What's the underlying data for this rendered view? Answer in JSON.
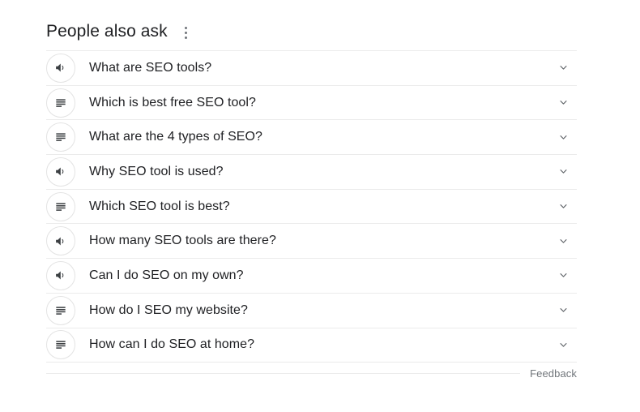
{
  "module": {
    "title": "People also ask",
    "kebab_menu_label": "More options",
    "feedback_label": "Feedback"
  },
  "questions": [
    {
      "text": "What are SEO tools?",
      "icon": "speaker-icon",
      "expand_icon": "chevron-down-icon"
    },
    {
      "text": "Which is best free SEO tool?",
      "icon": "text-lines-icon",
      "expand_icon": "chevron-down-icon"
    },
    {
      "text": "What are the 4 types of SEO?",
      "icon": "text-lines-icon",
      "expand_icon": "chevron-down-icon"
    },
    {
      "text": "Why SEO tool is used?",
      "icon": "speaker-icon",
      "expand_icon": "chevron-down-icon"
    },
    {
      "text": "Which SEO tool is best?",
      "icon": "text-lines-icon",
      "expand_icon": "chevron-down-icon"
    },
    {
      "text": "How many SEO tools are there?",
      "icon": "speaker-icon",
      "expand_icon": "chevron-down-icon"
    },
    {
      "text": "Can I do SEO on my own?",
      "icon": "speaker-icon",
      "expand_icon": "chevron-down-icon"
    },
    {
      "text": "How do I SEO my website?",
      "icon": "text-lines-icon",
      "expand_icon": "chevron-down-icon"
    },
    {
      "text": "How can I do SEO at home?",
      "icon": "text-lines-icon",
      "expand_icon": "chevron-down-icon"
    }
  ],
  "colors": {
    "text_primary": "#202124",
    "text_secondary": "#70757a",
    "divider": "#ebebeb",
    "icon_ring": "#e3e3e3",
    "background": "#ffffff"
  }
}
